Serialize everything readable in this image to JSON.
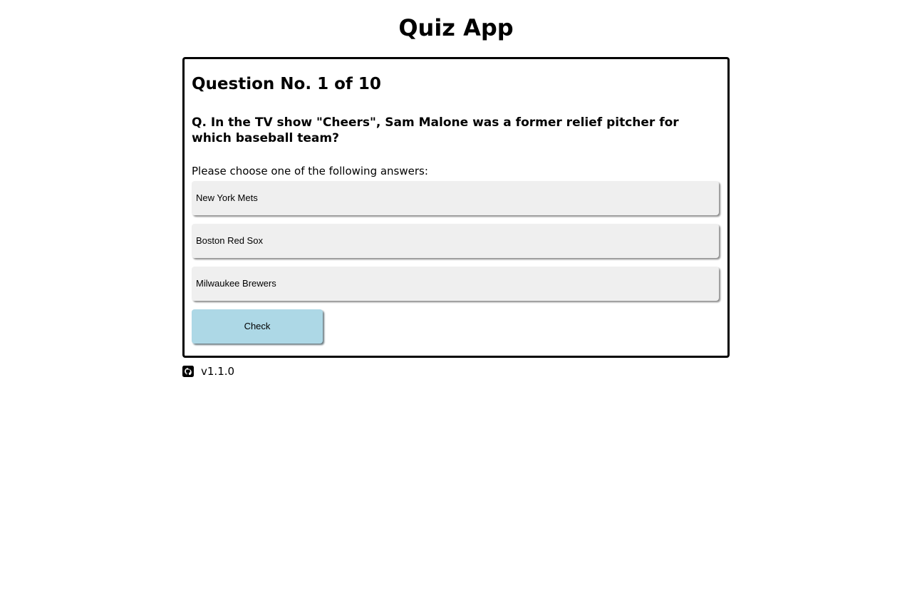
{
  "app": {
    "title": "Quiz App"
  },
  "quiz": {
    "question_number": "Question No. 1 of 10",
    "question_text": "Q. In the TV show \"Cheers\", Sam Malone was a former relief pitcher for which baseball team?",
    "instructions": "Please choose one of the following answers:",
    "answers": [
      "New York Mets",
      "Boston Red Sox",
      "Milwaukee Brewers"
    ],
    "check_label": "Check"
  },
  "footer": {
    "icon": "github-icon",
    "version": "v1.1.0"
  },
  "colors": {
    "answer_background": "#efefef",
    "check_background": "#add8e6",
    "card_border": "#000000"
  }
}
